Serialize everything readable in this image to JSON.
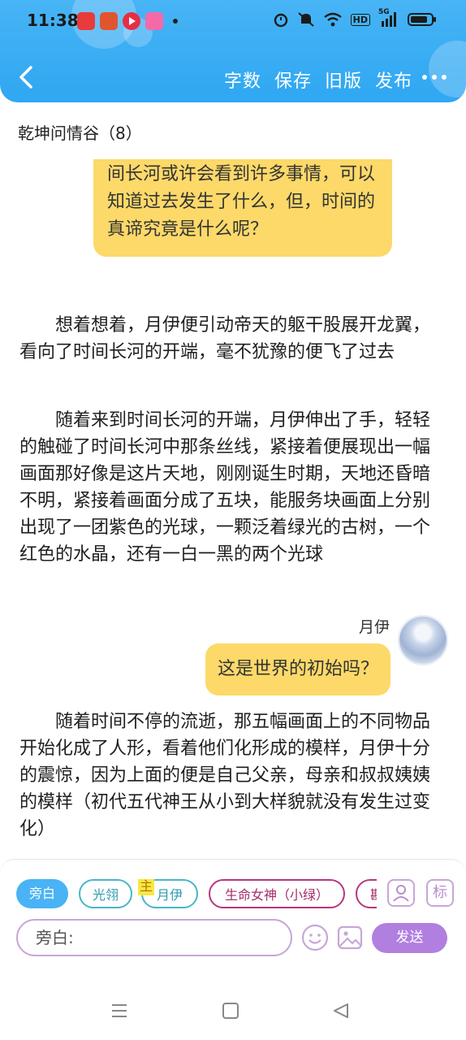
{
  "status_bar": {
    "time": "11:38",
    "notification_icons": [
      "toutiao-icon",
      "app-icon",
      "video-icon",
      "bilibili-icon"
    ],
    "system_icons": [
      "alarm-icon",
      "mute-icon",
      "wifi-icon",
      "hd-icon",
      "signal-5g-icon",
      "battery-icon"
    ],
    "hd_label": "HD",
    "net_label": "5G"
  },
  "header": {
    "actions": [
      "字数",
      "保存",
      "旧版",
      "发布"
    ]
  },
  "chapter": {
    "title": "乾坤问情谷（8）"
  },
  "content": {
    "top_speech": "时间长河连串古今与未来，通过时间长河或许会看到许多事情，可以知道过去发生了什么，但，时间的真谛究竟是什么呢？",
    "paragraph_1": "想着想着，月伊便引动帝天的躯干股展开龙翼，看向了时间长河的开端，毫不犹豫的便飞了过去",
    "paragraph_2": "随着来到时间长河的开端，月伊伸出了手，轻轻的触碰了时间长河中那条丝线，紧接着便展现出一幅画面那好像是这片天地，刚刚诞生时期，天地还昏暗不明，紧接着画面分成了五块，能服务块画面上分别出现了一团紫色的光球，一颗泛着绿光的古树，一个红色的水晶，还有一白一黑的两个光球",
    "speaker": "月伊",
    "speech_2": "这是世界的初始吗？",
    "paragraph_3": "随着时间不停的流逝，那五幅画面上的不同物品开始化成了人形，看着他们化形成的模样，月伊十分的震惊，因为上面的便是自己父亲，母亲和叔叔姨姨的模样（初代五代神王从小到大样貌就没有发生过变化）"
  },
  "toolbar": {
    "chips": [
      "旁白",
      "光翎",
      "月伊",
      "生命女神（小绿）",
      "斟"
    ],
    "main_tag": "主",
    "side_labels": [
      "人",
      "标"
    ],
    "input_placeholder": "旁白:",
    "send_label": "发送"
  },
  "colors": {
    "header_blue": "#2fa7f2",
    "speech_yellow": "#fcd969",
    "send_purple": "#b07fe0",
    "chip_teal": "#47b6c9",
    "chip_magenta": "#b8367c"
  }
}
